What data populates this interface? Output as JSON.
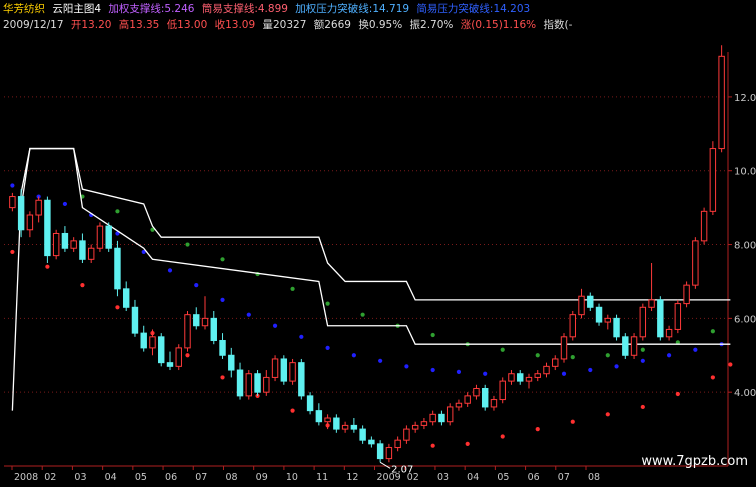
{
  "header": {
    "stock_name": "华芳纺织",
    "indicator_name": "云阳主图4",
    "legend": [
      {
        "label": "加权支撑线:5.246",
        "color": "#c060ff"
      },
      {
        "label": "筒易支撑线:4.899",
        "color": "#ff6070"
      },
      {
        "label": "加权压力突破线:14.719",
        "color": "#4fb0ff"
      },
      {
        "label": "简易压力突破线:14.203",
        "color": "#2f60ff"
      }
    ],
    "ohlc_row": [
      {
        "label": "2009/12/17",
        "color": "#dddddd"
      },
      {
        "label": "开13.20",
        "color": "#ff5050"
      },
      {
        "label": "高13.35",
        "color": "#ff5050"
      },
      {
        "label": "低13.00",
        "color": "#ff5050"
      },
      {
        "label": "收13.09",
        "color": "#ff5050"
      },
      {
        "label": "量20327",
        "color": "#dddddd"
      },
      {
        "label": "额2669",
        "color": "#dddddd"
      },
      {
        "label": "换0.95%",
        "color": "#dddddd"
      },
      {
        "label": "振2.70%",
        "color": "#dddddd"
      },
      {
        "label": "涨(0.15)1.16%",
        "color": "#ff5050"
      },
      {
        "label": "指数(-",
        "color": "#dddddd"
      }
    ]
  },
  "low_annotation": "2.07",
  "watermark": "www.7gpzb.com",
  "colors": {
    "up": "#ff3a3a",
    "down": "#5ff0f0",
    "white_line": "#ffffff",
    "green_dots": "#2fa030",
    "blue_dots": "#2020ff",
    "red_dots": "#ff3030",
    "grid": "#7a1a1a",
    "axis": "#b02020",
    "tick_text": "#c8c8c8"
  },
  "chart_data": {
    "type": "candlestick",
    "ylim": [
      2.0,
      13.0
    ],
    "yticks": [
      "4.00",
      "6.00",
      "8.00",
      "10.00",
      "12.00"
    ],
    "xtick_labels": [
      "2008",
      "02",
      "03",
      "04",
      "05",
      "06",
      "07",
      "08",
      "09",
      "10",
      "11",
      "12",
      "2009",
      "02",
      "03",
      "04",
      "05",
      "06",
      "07",
      "08"
    ],
    "candles": [
      [
        9.0,
        9.4,
        8.9,
        9.3
      ],
      [
        9.3,
        9.5,
        8.2,
        8.4
      ],
      [
        8.4,
        8.9,
        8.2,
        8.8
      ],
      [
        8.8,
        9.3,
        8.6,
        9.2
      ],
      [
        9.2,
        9.3,
        7.5,
        7.7
      ],
      [
        7.7,
        8.4,
        7.6,
        8.3
      ],
      [
        8.3,
        8.5,
        7.8,
        7.9
      ],
      [
        7.9,
        8.2,
        7.8,
        8.1
      ],
      [
        8.1,
        8.3,
        7.5,
        7.6
      ],
      [
        7.6,
        8.0,
        7.5,
        7.9
      ],
      [
        7.9,
        8.6,
        7.8,
        8.5
      ],
      [
        8.5,
        8.6,
        7.8,
        7.9
      ],
      [
        7.9,
        8.1,
        6.6,
        6.8
      ],
      [
        6.8,
        7.0,
        6.2,
        6.3
      ],
      [
        6.3,
        6.5,
        5.5,
        5.6
      ],
      [
        5.6,
        5.8,
        5.1,
        5.2
      ],
      [
        5.2,
        5.7,
        5.0,
        5.5
      ],
      [
        5.5,
        5.6,
        4.7,
        4.8
      ],
      [
        4.8,
        5.1,
        4.6,
        4.7
      ],
      [
        4.7,
        5.3,
        4.6,
        5.2
      ],
      [
        5.2,
        6.2,
        5.1,
        6.1
      ],
      [
        6.1,
        6.3,
        5.7,
        5.8
      ],
      [
        5.8,
        6.6,
        5.7,
        6.0
      ],
      [
        6.0,
        6.2,
        5.3,
        5.4
      ],
      [
        5.4,
        5.6,
        4.9,
        5.0
      ],
      [
        5.0,
        5.2,
        4.4,
        4.6
      ],
      [
        4.6,
        4.8,
        3.8,
        3.9
      ],
      [
        3.9,
        4.6,
        3.8,
        4.5
      ],
      [
        4.5,
        4.6,
        3.9,
        4.0
      ],
      [
        4.0,
        4.6,
        3.9,
        4.4
      ],
      [
        4.4,
        5.0,
        4.3,
        4.9
      ],
      [
        4.9,
        5.0,
        4.2,
        4.3
      ],
      [
        4.3,
        4.9,
        4.2,
        4.8
      ],
      [
        4.8,
        4.9,
        3.8,
        3.9
      ],
      [
        3.9,
        4.0,
        3.4,
        3.5
      ],
      [
        3.5,
        3.7,
        3.1,
        3.2
      ],
      [
        3.2,
        3.4,
        3.0,
        3.3
      ],
      [
        3.3,
        3.4,
        2.9,
        3.0
      ],
      [
        3.0,
        3.2,
        2.9,
        3.1
      ],
      [
        3.1,
        3.3,
        2.9,
        3.0
      ],
      [
        3.0,
        3.1,
        2.6,
        2.7
      ],
      [
        2.7,
        2.8,
        2.5,
        2.6
      ],
      [
        2.6,
        2.7,
        2.1,
        2.2
      ],
      [
        2.2,
        2.6,
        2.1,
        2.5
      ],
      [
        2.5,
        2.8,
        2.4,
        2.7
      ],
      [
        2.7,
        3.1,
        2.6,
        3.0
      ],
      [
        3.0,
        3.2,
        2.9,
        3.1
      ],
      [
        3.1,
        3.3,
        3.0,
        3.2
      ],
      [
        3.2,
        3.5,
        3.1,
        3.4
      ],
      [
        3.4,
        3.5,
        3.1,
        3.2
      ],
      [
        3.2,
        3.7,
        3.1,
        3.6
      ],
      [
        3.6,
        3.8,
        3.5,
        3.7
      ],
      [
        3.7,
        4.0,
        3.6,
        3.9
      ],
      [
        3.9,
        4.2,
        3.8,
        4.1
      ],
      [
        4.1,
        4.2,
        3.5,
        3.6
      ],
      [
        3.6,
        3.9,
        3.5,
        3.8
      ],
      [
        3.8,
        4.4,
        3.7,
        4.3
      ],
      [
        4.3,
        4.6,
        4.2,
        4.5
      ],
      [
        4.5,
        4.6,
        4.2,
        4.3
      ],
      [
        4.3,
        4.5,
        4.1,
        4.4
      ],
      [
        4.4,
        4.6,
        4.3,
        4.5
      ],
      [
        4.5,
        4.8,
        4.4,
        4.7
      ],
      [
        4.7,
        5.0,
        4.6,
        4.9
      ],
      [
        4.9,
        5.6,
        4.8,
        5.5
      ],
      [
        5.5,
        6.2,
        5.4,
        6.1
      ],
      [
        6.1,
        6.8,
        6.0,
        6.6
      ],
      [
        6.6,
        6.7,
        6.2,
        6.3
      ],
      [
        6.3,
        6.4,
        5.8,
        5.9
      ],
      [
        5.9,
        6.1,
        5.7,
        6.0
      ],
      [
        6.0,
        6.1,
        5.4,
        5.5
      ],
      [
        5.5,
        5.6,
        4.9,
        5.0
      ],
      [
        5.0,
        5.6,
        4.9,
        5.5
      ],
      [
        5.5,
        6.4,
        5.4,
        6.3
      ],
      [
        6.3,
        7.5,
        6.2,
        6.5
      ],
      [
        6.5,
        6.6,
        5.4,
        5.5
      ],
      [
        5.5,
        5.8,
        5.4,
        5.7
      ],
      [
        5.7,
        6.5,
        5.6,
        6.4
      ],
      [
        6.4,
        7.0,
        6.3,
        6.9
      ],
      [
        6.9,
        8.2,
        6.8,
        8.1
      ],
      [
        8.1,
        9.0,
        8.0,
        8.9
      ],
      [
        8.9,
        10.8,
        8.8,
        10.6
      ],
      [
        10.6,
        13.4,
        10.5,
        13.1
      ]
    ],
    "white_line_1": [
      [
        0,
        3.5
      ],
      [
        1,
        9.4
      ],
      [
        2,
        10.6
      ],
      [
        7,
        10.6
      ],
      [
        8,
        9.5
      ],
      [
        15,
        9.1
      ],
      [
        16,
        8.5
      ],
      [
        17,
        8.2
      ],
      [
        35,
        8.2
      ],
      [
        36,
        7.5
      ],
      [
        38,
        7.0
      ],
      [
        45,
        7.0
      ],
      [
        46,
        6.5
      ],
      [
        82,
        6.5
      ]
    ],
    "white_line_2": [
      [
        1,
        9.0
      ],
      [
        2,
        10.6
      ],
      [
        7,
        10.6
      ],
      [
        8,
        9.0
      ],
      [
        15,
        7.9
      ],
      [
        16,
        7.6
      ],
      [
        35,
        7.0
      ],
      [
        36,
        5.8
      ],
      [
        45,
        5.8
      ],
      [
        46,
        5.3
      ],
      [
        82,
        5.3
      ]
    ],
    "green_dots": [
      [
        8,
        9.3
      ],
      [
        12,
        8.9
      ],
      [
        16,
        8.4
      ],
      [
        20,
        8.0
      ],
      [
        24,
        7.6
      ],
      [
        28,
        7.2
      ],
      [
        32,
        6.8
      ],
      [
        36,
        6.4
      ],
      [
        40,
        6.1
      ],
      [
        44,
        5.8
      ],
      [
        48,
        5.55
      ],
      [
        52,
        5.3
      ],
      [
        56,
        5.15
      ],
      [
        60,
        5.0
      ],
      [
        64,
        4.95
      ],
      [
        68,
        5.0
      ],
      [
        72,
        5.15
      ],
      [
        76,
        5.35
      ],
      [
        80,
        5.65
      ]
    ],
    "blue_dots": [
      [
        0,
        9.6
      ],
      [
        3,
        9.3
      ],
      [
        6,
        9.1
      ],
      [
        9,
        8.8
      ],
      [
        12,
        8.3
      ],
      [
        15,
        7.8
      ],
      [
        18,
        7.3
      ],
      [
        21,
        6.9
      ],
      [
        24,
        6.5
      ],
      [
        27,
        6.1
      ],
      [
        30,
        5.8
      ],
      [
        33,
        5.5
      ],
      [
        36,
        5.2
      ],
      [
        39,
        5.0
      ],
      [
        42,
        4.85
      ],
      [
        45,
        4.7
      ],
      [
        48,
        4.6
      ],
      [
        51,
        4.55
      ],
      [
        54,
        4.5
      ],
      [
        57,
        4.45
      ],
      [
        60,
        4.45
      ],
      [
        63,
        4.5
      ],
      [
        66,
        4.6
      ],
      [
        69,
        4.7
      ],
      [
        72,
        4.85
      ],
      [
        75,
        5.0
      ],
      [
        78,
        5.15
      ],
      [
        81,
        5.3
      ]
    ],
    "red_dots": [
      [
        0,
        7.8
      ],
      [
        4,
        7.4
      ],
      [
        8,
        6.9
      ],
      [
        12,
        6.3
      ],
      [
        16,
        5.6
      ],
      [
        20,
        5.0
      ],
      [
        24,
        4.4
      ],
      [
        28,
        3.9
      ],
      [
        32,
        3.5
      ],
      [
        36,
        3.1
      ],
      [
        40,
        2.8
      ],
      [
        44,
        2.6
      ],
      [
        48,
        2.55
      ],
      [
        52,
        2.6
      ],
      [
        56,
        2.8
      ],
      [
        60,
        3.0
      ],
      [
        64,
        3.2
      ],
      [
        68,
        3.4
      ],
      [
        72,
        3.6
      ],
      [
        76,
        3.95
      ],
      [
        80,
        4.4
      ],
      [
        82,
        4.75
      ]
    ]
  }
}
